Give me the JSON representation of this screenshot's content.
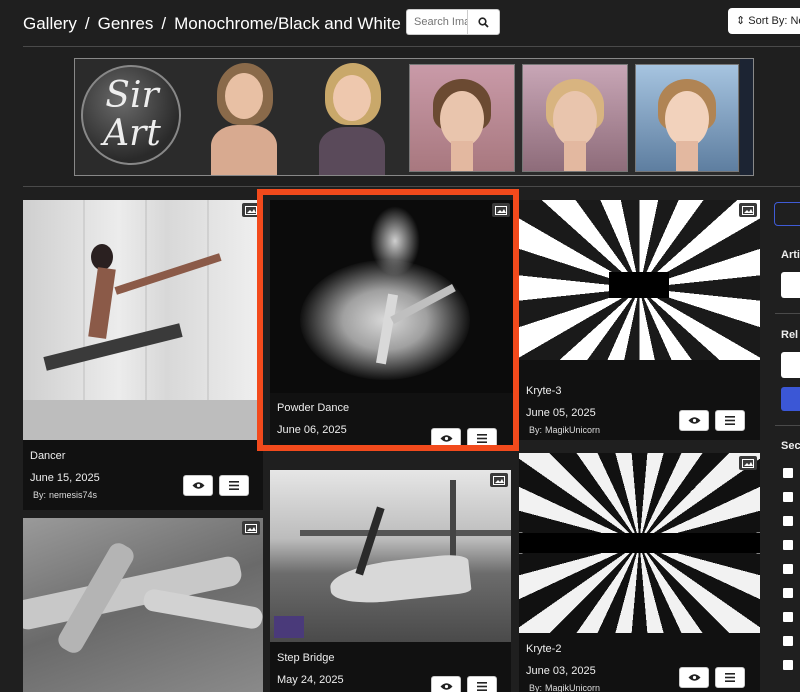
{
  "breadcrumb": {
    "gallery": "Gallery",
    "genres": "Genres",
    "current": "Monochrome/Black and White",
    "separator": "/"
  },
  "search": {
    "placeholder": "Search Images"
  },
  "sort": {
    "label": "Sort By: Newest"
  },
  "banner": {
    "logo_line1": "Sir",
    "logo_line2": "Art"
  },
  "cards": [
    {
      "title": "Dancer",
      "date": "June 15, 2025",
      "by_label": "By:",
      "author": "nemesis74s"
    },
    {
      "title": "Powder Dance",
      "date": "June 06, 2025"
    },
    {
      "title": "Kryte-3",
      "date": "June 05, 2025",
      "by_label": "By:",
      "author": "MagikUnicorn"
    },
    {
      "title": "Step Bridge",
      "date": "May 24, 2025"
    },
    {
      "title": "Kryte-2",
      "date": "June 03, 2025",
      "by_label": "By:",
      "author": "MagikUnicorn"
    }
  ],
  "sidebar": {
    "label1": "Arti",
    "label2": "Rel",
    "label3": "Sec"
  },
  "colors": {
    "highlight": "#f24a1c",
    "accent": "#3b57d6"
  },
  "icons": [
    "image-icon",
    "eye-icon",
    "menu-icon",
    "search-icon",
    "sort-icon"
  ]
}
